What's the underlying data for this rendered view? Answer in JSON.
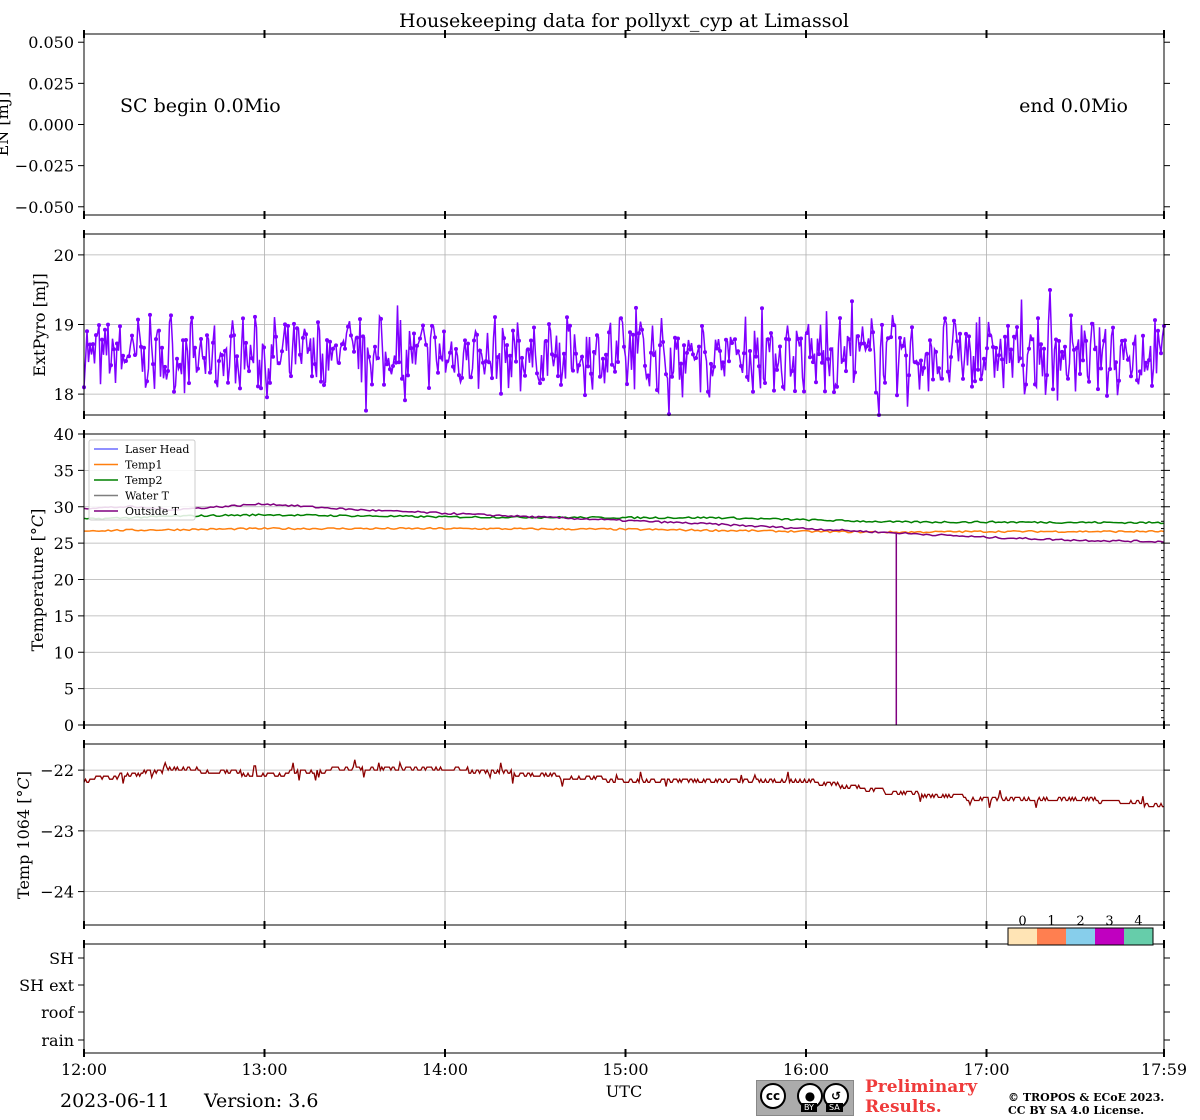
{
  "title": "Housekeeping data for pollyxt_cyp at Limassol",
  "x_axis": {
    "label": "UTC",
    "ticks": [
      "12:00",
      "13:00",
      "14:00",
      "15:00",
      "16:00",
      "17:00",
      "17:59"
    ],
    "range": [
      "12:00",
      "17:59"
    ]
  },
  "date": "2023-06-11",
  "version": "Version: 3.6",
  "preliminary": [
    "Preliminary",
    "Results."
  ],
  "copyright": [
    "© TROPOS & ECoE 2023.",
    "CC BY SA 4.0 License."
  ],
  "cc_badge": {
    "by": "BY",
    "sa": "SA",
    "icon_names": [
      "cc-icon",
      "by-icon",
      "sa-icon"
    ]
  },
  "colors": {
    "laser_energy": "#7f00ff",
    "laser_head": "#6b6bff",
    "temp1": "#ff7f0e",
    "temp2": "#008000",
    "water_t": "#7f7f7f",
    "outside_t": "#800080",
    "temp1064": "#8b0000",
    "shutter_0": "#ffe4b5",
    "shutter_1": "#ff7f50",
    "shutter_2": "#87ceeb",
    "shutter_3": "#c000c0",
    "shutter_4": "#66cdaa"
  },
  "chart_data": [
    {
      "type": "line",
      "ylabel": "EN [mJ]",
      "ylim": [
        -0.055,
        0.055
      ],
      "yticks": [
        "0.050",
        "0.025",
        "0.000",
        "−0.025",
        "−0.050"
      ],
      "ytick_values": [
        0.05,
        0.025,
        0.0,
        -0.025,
        -0.05
      ],
      "grid": false,
      "annotations": [
        "SC begin 0.0Mio",
        "end 0.0Mio"
      ],
      "series": []
    },
    {
      "type": "line",
      "ylabel": "ExtPyro [mJ]",
      "ylim": [
        17.7,
        20.3
      ],
      "yticks": [
        "20",
        "19",
        "18"
      ],
      "ytick_values": [
        20,
        19,
        18
      ],
      "grid": true,
      "series": [
        {
          "x_range": [
            "12:00",
            "17:59"
          ],
          "center": 18.55,
          "min": 17.7,
          "max": 19.5,
          "marker": "dot"
        }
      ]
    },
    {
      "type": "line",
      "ylabel": "Temperature [$^\\circ C$]",
      "ylim": [
        0,
        40
      ],
      "yticks": [
        "40",
        "35",
        "30",
        "25",
        "20",
        "15",
        "10",
        "5",
        "0"
      ],
      "ytick_values": [
        40,
        35,
        30,
        25,
        20,
        15,
        10,
        5,
        0
      ],
      "grid": true,
      "legend": {
        "placement": "upper-left",
        "entries": [
          "Laser Head",
          "Temp1",
          "Temp2",
          "Water T",
          "Outside T"
        ]
      },
      "series": [
        {
          "name": "Laser Head",
          "x": [],
          "y": []
        },
        {
          "name": "Temp1",
          "x": [
            "12:00",
            "13:00",
            "14:00",
            "15:00",
            "16:00",
            "16:30",
            "17:00",
            "17:59"
          ],
          "y": [
            26.7,
            27.0,
            27.0,
            26.9,
            26.6,
            26.5,
            26.6,
            26.6
          ]
        },
        {
          "name": "Temp2",
          "x": [
            "12:00",
            "12:30",
            "13:00",
            "14:00",
            "15:00",
            "15:30",
            "16:00",
            "16:30",
            "17:00",
            "17:59"
          ],
          "y": [
            28.3,
            28.7,
            28.9,
            28.6,
            28.5,
            28.5,
            28.2,
            27.9,
            27.9,
            27.8
          ]
        },
        {
          "name": "Water T",
          "x": [],
          "y": []
        },
        {
          "name": "Outside T",
          "x": [
            "12:00",
            "12:15",
            "12:30",
            "13:00",
            "13:30",
            "14:00",
            "14:30",
            "15:00",
            "15:30",
            "16:00",
            "16:30",
            "17:00",
            "17:30",
            "17:59"
          ],
          "y": [
            29.8,
            30.0,
            29.6,
            30.4,
            29.6,
            29.1,
            28.6,
            28.1,
            27.6,
            27.0,
            26.4,
            25.8,
            25.4,
            25.2
          ]
        }
      ],
      "drop": {
        "series": "Outside T",
        "x": "16:30",
        "from": 26.4,
        "to": 0
      }
    },
    {
      "type": "line",
      "ylabel": "Temp 1064 [$^\\circ C$]",
      "ylim": [
        -24.55,
        -21.57
      ],
      "yticks": [
        "−22",
        "−23",
        "−24"
      ],
      "ytick_values": [
        -22,
        -23,
        -24
      ],
      "grid": true,
      "series": [
        {
          "x": [
            "12:00",
            "12:30",
            "13:00",
            "13:30",
            "14:00",
            "14:30",
            "15:00",
            "15:30",
            "16:00",
            "16:30",
            "17:00",
            "17:30",
            "17:59"
          ],
          "y": [
            -22.2,
            -22.0,
            -22.1,
            -22.0,
            -22.0,
            -22.1,
            -22.2,
            -22.2,
            -22.2,
            -22.4,
            -22.5,
            -22.5,
            -22.6
          ]
        }
      ]
    },
    {
      "type": "heatmap",
      "ylabel": "",
      "ycategories": [
        "SH",
        "SH ext",
        "roof",
        "rain"
      ],
      "colorbar": {
        "labels": [
          "0",
          "1",
          "2",
          "3",
          "4"
        ]
      },
      "values": []
    }
  ]
}
